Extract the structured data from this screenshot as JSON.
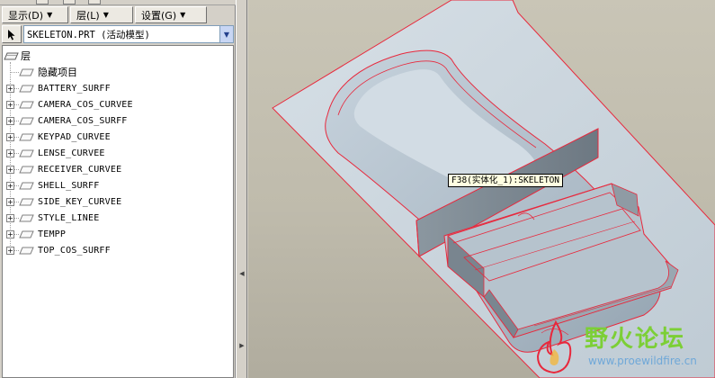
{
  "menus": [
    {
      "label": "显示(D)"
    },
    {
      "label": "层(L)"
    },
    {
      "label": "设置(G)"
    }
  ],
  "model_select": {
    "value": "SKELETON.PRT (活动模型)"
  },
  "tree": {
    "root": "层",
    "hidden": "隐藏项目",
    "layers": [
      "BATTERY_SURFF",
      "CAMERA_COS_CURVEE",
      "CAMERA_COS_SURFF",
      "KEYPAD_CURVEE",
      "LENSE_CURVEE",
      "RECEIVER_CURVEE",
      "SHELL_SURFF",
      "SIDE_KEY_CURVEE",
      "STYLE_LINEE",
      "TEMPP",
      "TOP_COS_SURFF"
    ]
  },
  "tooltip": "F38(实体化_1):SKELETON",
  "watermark": {
    "title": "野火论坛",
    "url": "www.proewildfire.cn"
  },
  "colors": {
    "edge": "#e8283c",
    "surface": "#cdd8e1",
    "viewport_bg": "#c6c2b3"
  },
  "icons": {
    "pointer": "arrow-pointer-icon",
    "layer": "layer-icon",
    "expander": "plus-expander-icon"
  }
}
